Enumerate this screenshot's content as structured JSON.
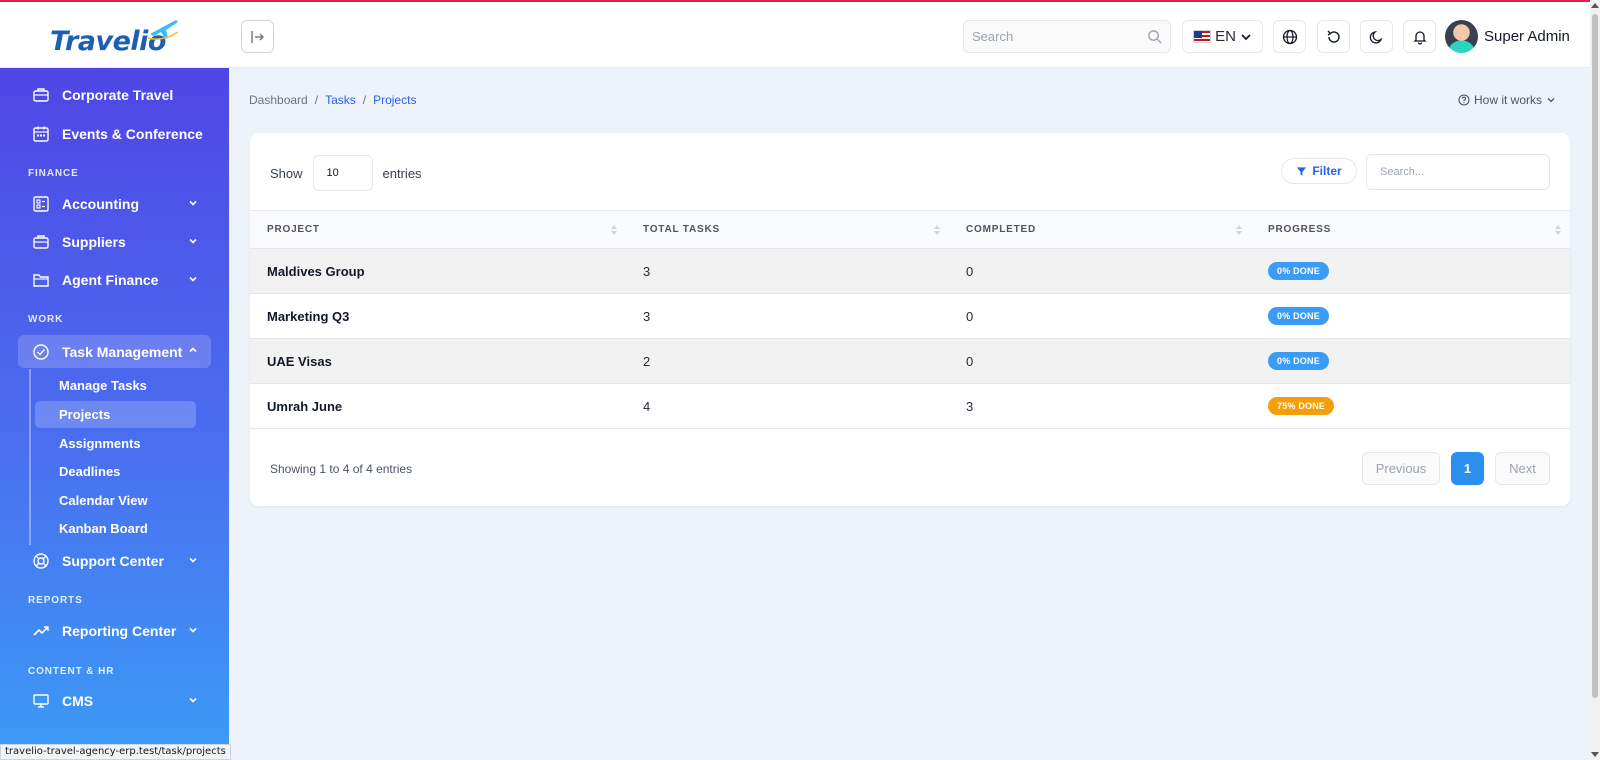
{
  "header": {
    "logo_text": "Travelio",
    "search_placeholder": "Search",
    "language": "EN",
    "user_name": "Super Admin"
  },
  "sidebar": {
    "items_top": [
      {
        "label": "Corporate Travel",
        "icon": "briefcase-icon"
      },
      {
        "label": "Events & Conference",
        "icon": "calendar-icon"
      }
    ],
    "section_finance": "FINANCE",
    "finance_items": [
      {
        "label": "Accounting",
        "icon": "ledger-icon"
      },
      {
        "label": "Suppliers",
        "icon": "briefcase-icon"
      },
      {
        "label": "Agent Finance",
        "icon": "folder-icon"
      }
    ],
    "section_work": "WORK",
    "task_management": {
      "label": "Task Management",
      "icon": "check-circle-icon",
      "expanded": true
    },
    "task_subitems": [
      {
        "label": "Manage Tasks"
      },
      {
        "label": "Projects",
        "active": true
      },
      {
        "label": "Assignments"
      },
      {
        "label": "Deadlines"
      },
      {
        "label": "Calendar View"
      },
      {
        "label": "Kanban Board"
      }
    ],
    "support_center": {
      "label": "Support Center",
      "icon": "lifebuoy-icon"
    },
    "section_reports": "REPORTS",
    "reporting_center": {
      "label": "Reporting Center",
      "icon": "trend-line-icon"
    },
    "section_content_hr": "CONTENT & HR",
    "cms": {
      "label": "CMS",
      "icon": "monitor-icon"
    }
  },
  "status_bar_url": "travelio-travel-agency-erp.test/task/projects",
  "breadcrumb": {
    "items": [
      "Dashboard",
      "Tasks",
      "Projects"
    ],
    "separator": "/"
  },
  "help": {
    "label": "How it works"
  },
  "table_controls": {
    "show_label": "Show",
    "page_size": "10",
    "entries_label": "entries",
    "filter_label": "Filter",
    "search_placeholder": "Search..."
  },
  "table": {
    "columns": [
      "PROJECT",
      "TOTAL TASKS",
      "COMPLETED",
      "PROGRESS"
    ],
    "rows": [
      {
        "project": "Maldives Group",
        "total": "3",
        "completed": "0",
        "progress": "0% DONE",
        "progress_color": "#3b9cf5"
      },
      {
        "project": "Marketing Q3",
        "total": "3",
        "completed": "0",
        "progress": "0% DONE",
        "progress_color": "#3b9cf5"
      },
      {
        "project": "UAE Visas",
        "total": "2",
        "completed": "0",
        "progress": "0% DONE",
        "progress_color": "#3b9cf5"
      },
      {
        "project": "Umrah June",
        "total": "4",
        "completed": "3",
        "progress": "75% DONE",
        "progress_color": "#f59e0b"
      }
    ]
  },
  "footer": {
    "showing_text": "Showing 1 to 4 of 4 entries",
    "previous_label": "Previous",
    "current_page": "1",
    "next_label": "Next"
  },
  "colors": {
    "accent": "#2b8fef",
    "sidebar_top": "#4f46e5",
    "sidebar_bottom": "#3b9cf5"
  }
}
